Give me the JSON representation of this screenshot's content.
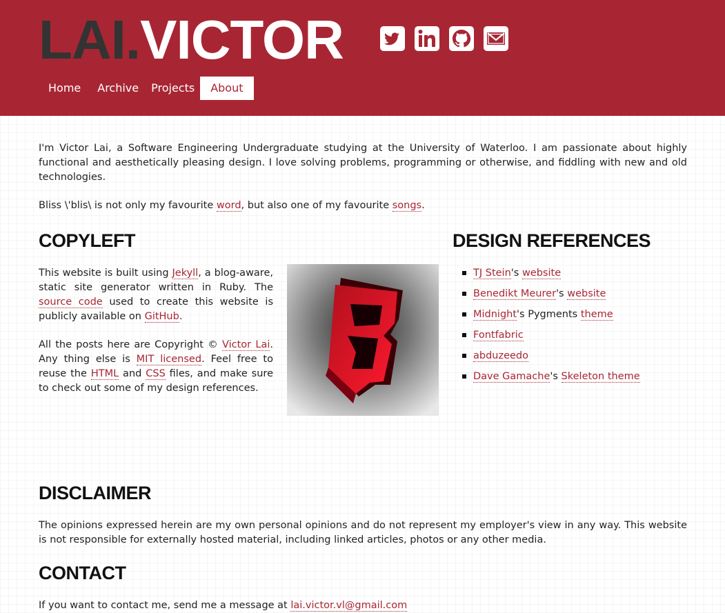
{
  "header": {
    "brand_first": "LAI",
    "brand_dot": ".",
    "brand_last": "VICTOR",
    "social": [
      "twitter-icon",
      "linkedin-icon",
      "github-icon",
      "email-icon"
    ],
    "accent_color": "#a82633"
  },
  "nav": {
    "items": [
      {
        "label": "Home",
        "active": false
      },
      {
        "label": "Archive",
        "active": false
      },
      {
        "label": "Projects",
        "active": false
      },
      {
        "label": "About",
        "active": true
      }
    ]
  },
  "intro": {
    "p1": "I'm Victor Lai, a Software Engineering Undergraduate studying at the University of Waterloo. I am passionate about highly functional and aesthetically pleasing design. I love solving problems, programming or otherwise, and fiddling with new and old technologies.",
    "p2_a": "Bliss \\'blis\\ is not only my favourite ",
    "p2_link1": "word",
    "p2_b": ", but also one of my favourite ",
    "p2_link2": "songs",
    "p2_c": "."
  },
  "copyleft": {
    "heading": "Copyleft",
    "p1_a": "This website is built using ",
    "p1_link1": "Jekyll",
    "p1_b": ", a blog-aware, static site generator written in Ruby. The ",
    "p1_link2": "source code",
    "p1_c": " used to create this website is publicly available on ",
    "p1_link3": "GitHub",
    "p1_d": ".",
    "p2_a": "All the posts here are Copyright © ",
    "p2_link1": "Victor Lai",
    "p2_b": ". Any thing else is ",
    "p2_link2": "MIT licensed",
    "p2_c": ". Feel free to reuse the ",
    "p2_link3": "HTML",
    "p2_d": " and ",
    "p2_link4": "CSS",
    "p2_e": " files, and make sure to check out some of my design references."
  },
  "design": {
    "heading": "Design References",
    "items": [
      {
        "link1": "TJ Stein",
        "mid": "'s ",
        "link2": "website"
      },
      {
        "link1": "Benedikt Meurer",
        "mid": "'s ",
        "link2": "website"
      },
      {
        "link1": "Midnight",
        "mid": "'s Pygments ",
        "link2": "theme"
      },
      {
        "link1": "Fontfabric",
        "mid": "",
        "link2": ""
      },
      {
        "link1": "abduzeedo",
        "mid": "",
        "link2": ""
      },
      {
        "link1": "Dave Gamache",
        "mid": "'s ",
        "link2": "Skeleton theme"
      }
    ]
  },
  "disclaimer": {
    "heading": "Disclaimer",
    "text": "The opinions expressed herein are my own personal opinions and do not represent my employer's view in any way. This website is not responsible for externally hosted material, including linked articles, photos or any other media."
  },
  "contact": {
    "heading": "Contact",
    "text": "If you want to contact me, send me a message at ",
    "email": "lai.victor.vl@gmail.com"
  }
}
